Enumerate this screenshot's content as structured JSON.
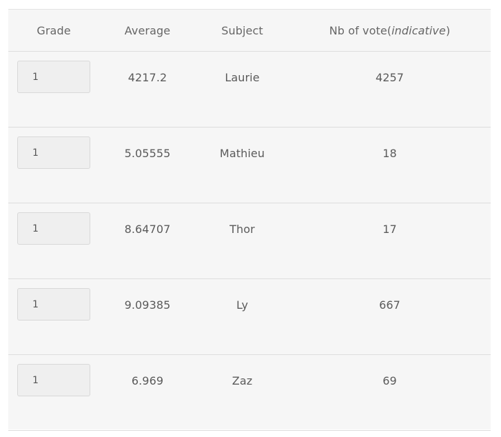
{
  "table": {
    "headers": {
      "grade": "Grade",
      "average": "Average",
      "subject": "Subject",
      "votes_prefix": "Nb of vote(",
      "votes_italic": "indicative",
      "votes_suffix": ")"
    },
    "rows": [
      {
        "grade": "1",
        "average": "4217.2",
        "subject": "Laurie",
        "votes": "4257"
      },
      {
        "grade": "1",
        "average": "5.05555",
        "subject": "Mathieu",
        "votes": "18"
      },
      {
        "grade": "1",
        "average": "8.64707",
        "subject": "Thor",
        "votes": "17"
      },
      {
        "grade": "1",
        "average": "9.09385",
        "subject": "Ly",
        "votes": "667"
      },
      {
        "grade": "1",
        "average": "6.969",
        "subject": "Zaz",
        "votes": "69"
      }
    ]
  }
}
